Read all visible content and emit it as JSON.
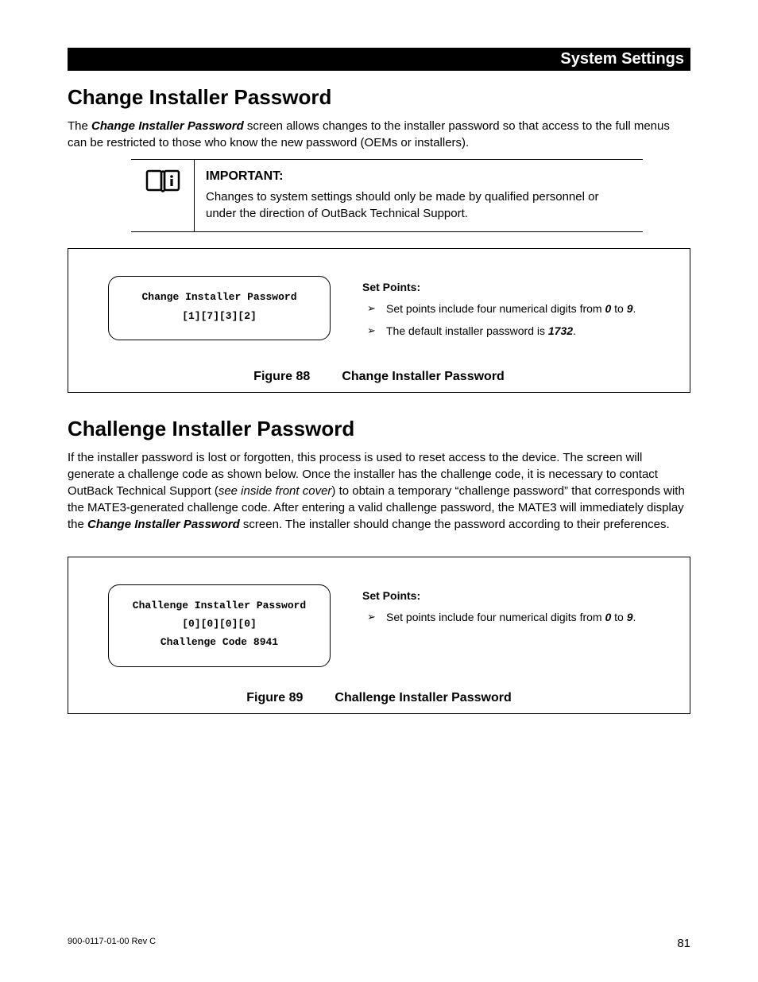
{
  "header": {
    "section": "System Settings"
  },
  "section1": {
    "title": "Change Installer Password",
    "intro_pre": "The ",
    "intro_emph": "Change Installer Password",
    "intro_post": " screen allows changes to the installer password so that access to the full menus can be restricted to those who know the new password (OEMs or installers)."
  },
  "important": {
    "label": "IMPORTANT:",
    "text": "Changes to system settings should only be made by qualified personnel or under the direction of OutBack Technical Support."
  },
  "figure88": {
    "screen_line1": "Change Installer Password",
    "screen_line2": "[1][7][3][2]",
    "sp_head": "Set Points:",
    "sp_items": [
      {
        "pre": "Set points include four numerical digits from ",
        "b1": "0",
        "mid": " to ",
        "b2": "9",
        "post": "."
      },
      {
        "pre": "The default installer password is ",
        "b1": "1732",
        "mid": "",
        "b2": "",
        "post": "."
      }
    ],
    "caption_num": "Figure 88",
    "caption_title": "Change Installer Password"
  },
  "section2": {
    "title": "Challenge Installer Password",
    "p_pre": "If the installer password is lost or forgotten, this process is used to reset access to the device.  The screen will generate a challenge code as shown below.  Once the installer has the challenge code, it is necessary to contact OutBack Technical Support (",
    "p_it": "see inside front cover",
    "p_mid": ") to obtain a temporary “challenge password” that corresponds with the MATE3-generated challenge code.  After entering a valid challenge password, the MATE3 will immediately display the ",
    "p_emph": "Change Installer Password",
    "p_post": " screen.  The installer should change the password according to their preferences."
  },
  "figure89": {
    "screen_line1": "Challenge Installer Password",
    "screen_line2": "[0][0][0][0]",
    "screen_line3": "Challenge Code 8941",
    "sp_head": "Set Points:",
    "sp_items": [
      {
        "pre": "Set points include four numerical digits from ",
        "b1": "0",
        "mid": " to ",
        "b2": "9",
        "post": "."
      }
    ],
    "caption_num": "Figure 89",
    "caption_title": "Challenge Installer Password"
  },
  "footer": {
    "rev": "900-0117-01-00 Rev C",
    "page": "81"
  }
}
